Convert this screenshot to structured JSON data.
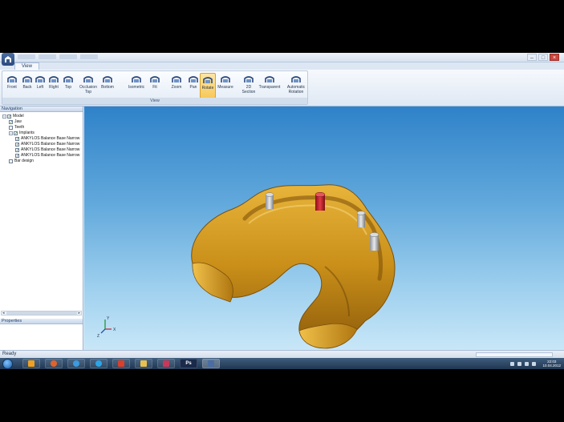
{
  "window": {
    "title": "",
    "buttons": [
      "–",
      "□",
      "×"
    ]
  },
  "ribbon": {
    "tab": "View",
    "group_label": "View",
    "buttons": [
      {
        "label": "Front"
      },
      {
        "label": "Back"
      },
      {
        "label": "Left"
      },
      {
        "label": "Right"
      },
      {
        "label": "Top"
      },
      {
        "label": "Occlusion\nTop"
      },
      {
        "label": "Bottom"
      },
      {
        "label": "Isometric"
      },
      {
        "label": "Fit"
      },
      {
        "label": "Zoom"
      },
      {
        "label": "Pan"
      },
      {
        "label": "Rotate"
      },
      {
        "label": "Measure"
      },
      {
        "label": "2D\nSection"
      },
      {
        "label": "Transparent"
      },
      {
        "label": "Automatic\nRotation"
      }
    ],
    "active_button": "Rotate"
  },
  "navigation": {
    "header": "Navigation",
    "tree": [
      {
        "label": "Model",
        "level": 0,
        "expand": "−",
        "checked": true
      },
      {
        "label": "Jaw",
        "level": 1,
        "checked": true
      },
      {
        "label": "Teeth",
        "level": 1,
        "checked": false
      },
      {
        "label": "Implants",
        "level": 1,
        "expand": "−",
        "checked": true
      },
      {
        "label": "ANKYLOS Balance Base Narrow",
        "level": 2,
        "checked": true
      },
      {
        "label": "ANKYLOS Balance Base Narrow",
        "level": 2,
        "checked": true
      },
      {
        "label": "ANKYLOS Balance Base Narrow",
        "level": 2,
        "checked": true
      },
      {
        "label": "ANKYLOS Balance Base Narrow",
        "level": 2,
        "checked": true
      },
      {
        "label": "Bar design",
        "level": 1,
        "checked": false
      }
    ]
  },
  "properties": {
    "header": "Properties"
  },
  "viewport": {
    "axes": {
      "x": "X",
      "y": "Y",
      "z": "Z"
    },
    "colors": {
      "model": "#d7a126",
      "implant": "#b9bcc0",
      "selected_implant": "#c0202a"
    }
  },
  "status": {
    "text": "Ready"
  },
  "taskbar": {
    "apps": [
      "start-icon",
      "media-player-icon",
      "firefox-icon",
      "ie-icon",
      "skype-icon",
      "office-icon",
      "folder-icon",
      "paint-icon",
      "photoshop-icon",
      "dental-app-icon"
    ],
    "photoshop_label": "Ps",
    "clock_time": "22:03",
    "clock_date": "10.04.2012"
  }
}
